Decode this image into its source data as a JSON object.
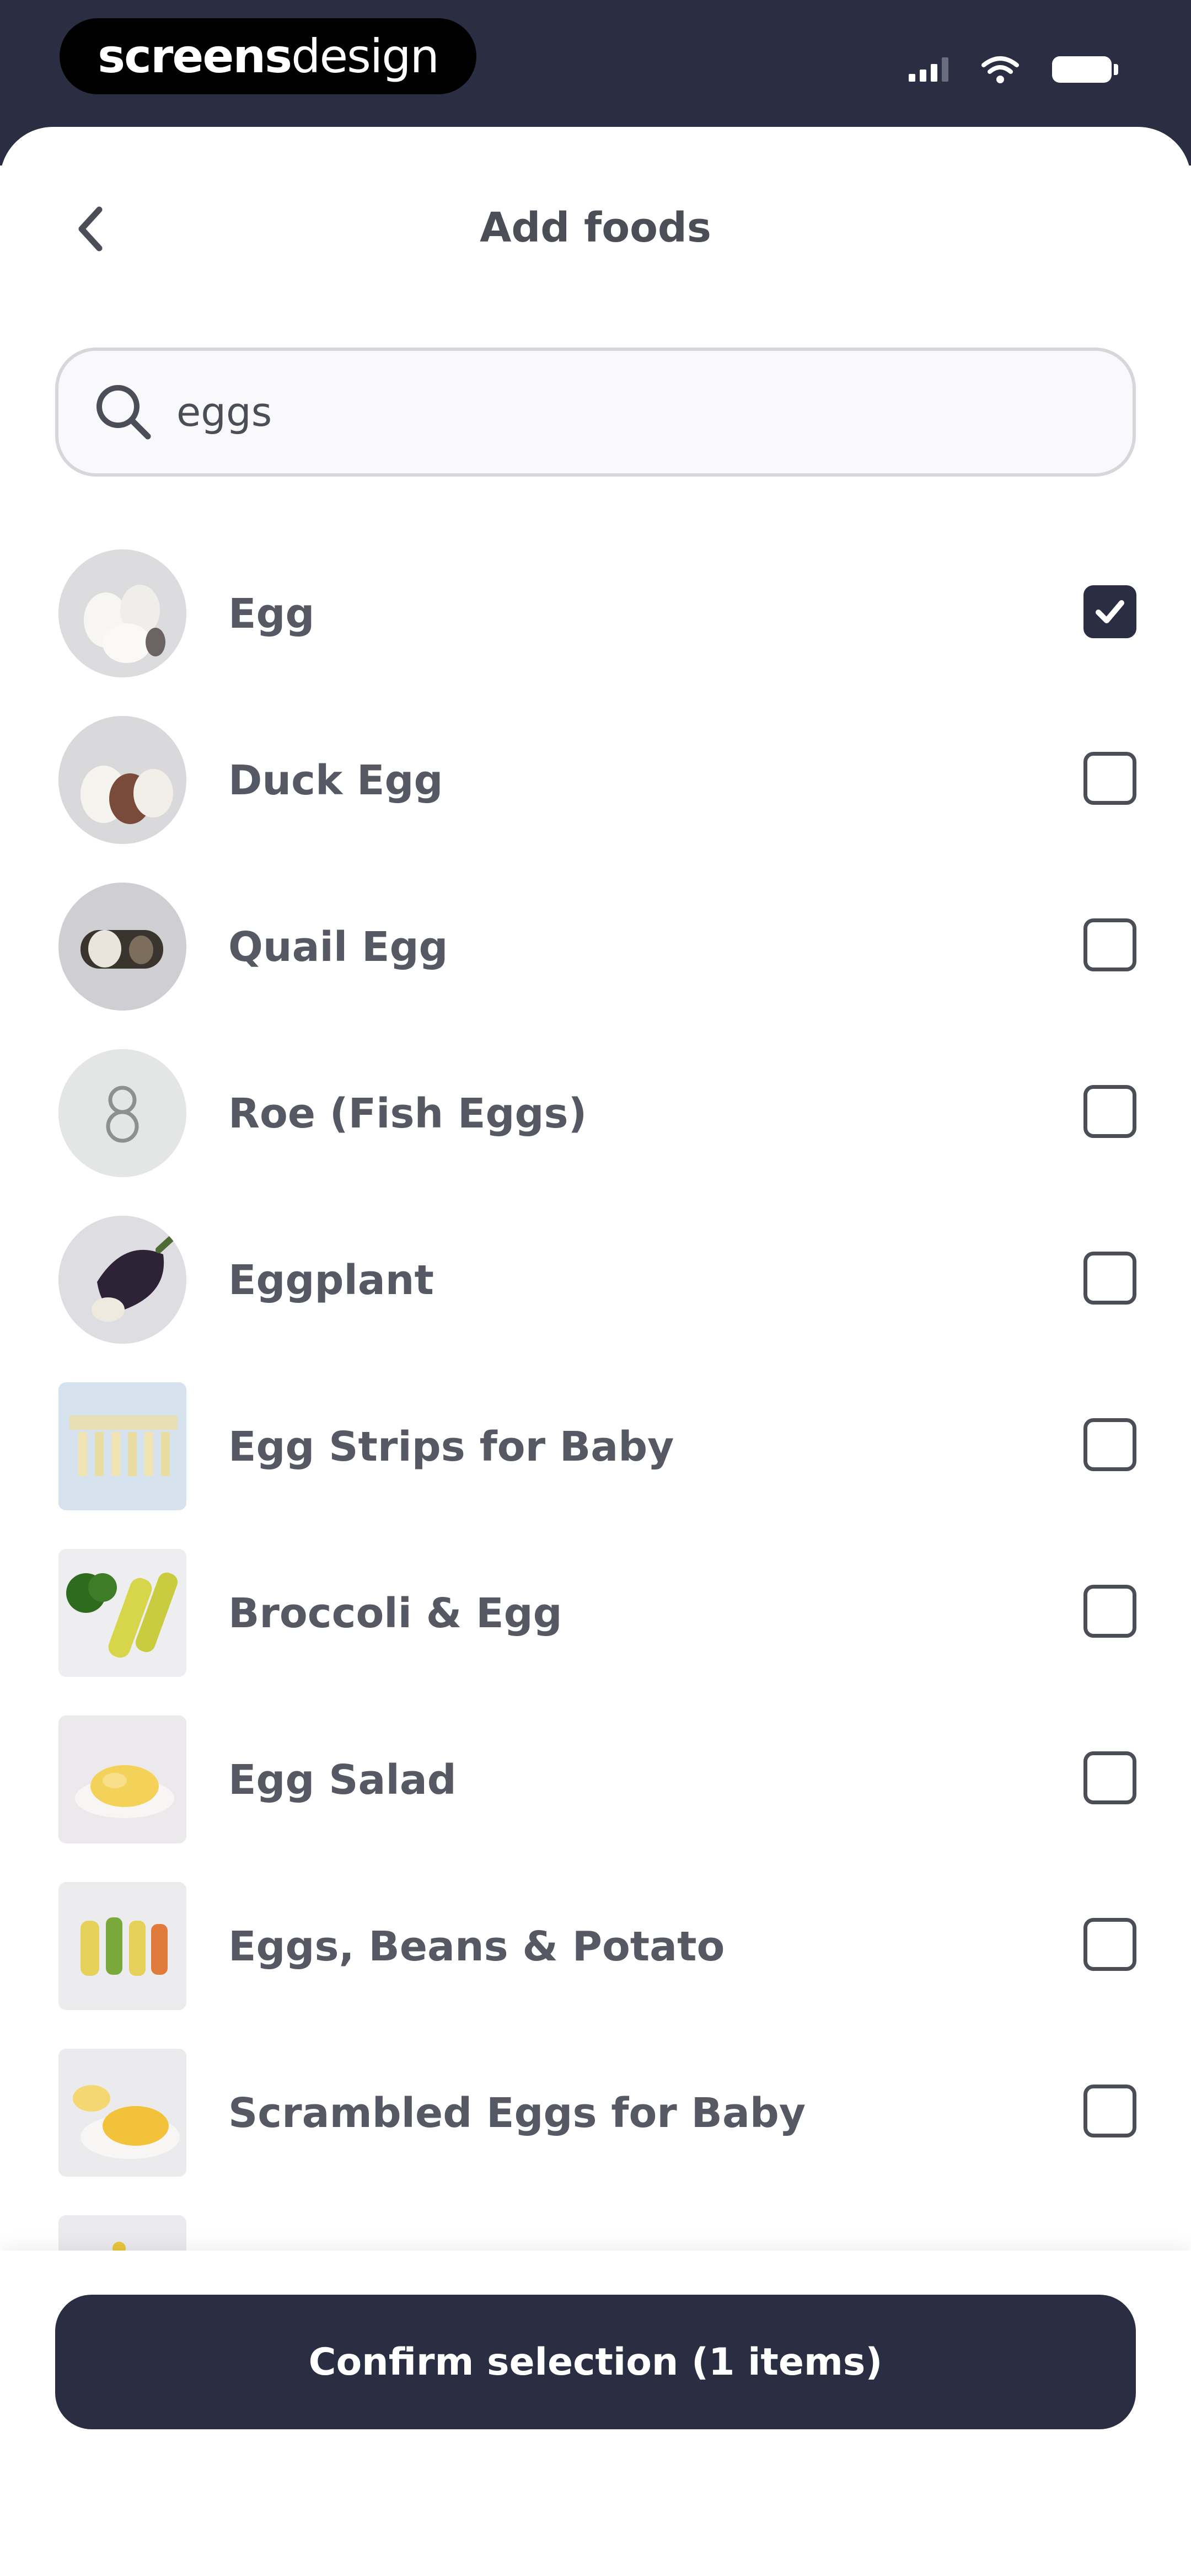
{
  "status_bar": {
    "brand_bold": "screens",
    "brand_light": "design",
    "icons": [
      "signal-icon",
      "wifi-icon",
      "battery-icon"
    ]
  },
  "header": {
    "title": "Add foods",
    "back_icon": "chevron-left-icon"
  },
  "search": {
    "value": "eggs",
    "placeholder": "",
    "icon": "search-icon"
  },
  "foods": [
    {
      "name": "Egg",
      "checked": true
    },
    {
      "name": "Duck Egg",
      "checked": false
    },
    {
      "name": "Quail Egg",
      "checked": false
    },
    {
      "name": "Roe (Fish Eggs)",
      "checked": false
    },
    {
      "name": "Eggplant",
      "checked": false
    },
    {
      "name": "Egg Strips for Baby",
      "checked": false
    },
    {
      "name": "Broccoli & Egg",
      "checked": false
    },
    {
      "name": "Egg Salad",
      "checked": false
    },
    {
      "name": "Eggs, Beans & Potato",
      "checked": false
    },
    {
      "name": "Scrambled Eggs for Baby",
      "checked": false
    }
  ],
  "footer": {
    "confirm_label": "Confirm selection (1 items)"
  },
  "colors": {
    "primary_dark": "#2b2e43",
    "text": "#4b4e57",
    "border": "#d6d7db"
  }
}
